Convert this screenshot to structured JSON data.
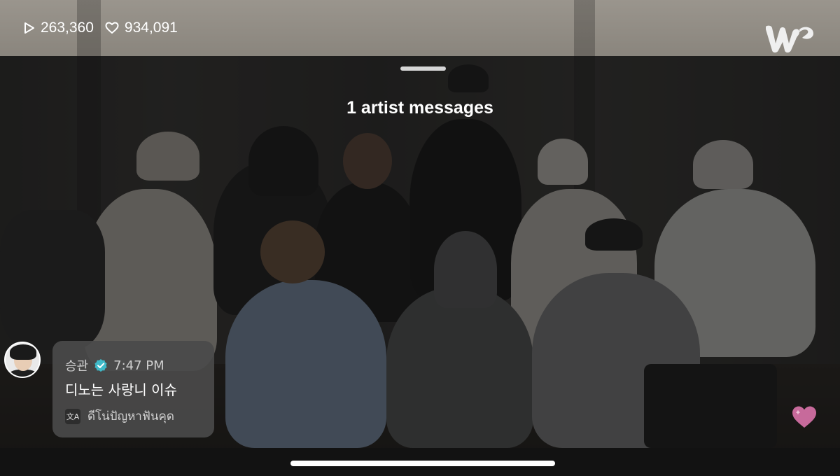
{
  "stats": {
    "plays": "263,360",
    "likes": "934,091",
    "play_icon": "play-icon",
    "like_icon": "heart-outline-icon"
  },
  "app": {
    "logo_icon": "weverse-logo-icon"
  },
  "sheet": {
    "title": "1 artist messages"
  },
  "message": {
    "author": "승관",
    "verified_icon": "verified-badge-icon",
    "time": "7:47 PM",
    "text": "디노는 사랑니 이슈",
    "translate_icon": "translate-icon",
    "translation": "ดีโน่ปัญหาฟันคุด"
  },
  "reaction": {
    "icon": "heart-icon",
    "color": "#c76a9b"
  },
  "colors": {
    "verified": "#3fb9c8",
    "card": "#4a4a4a"
  }
}
